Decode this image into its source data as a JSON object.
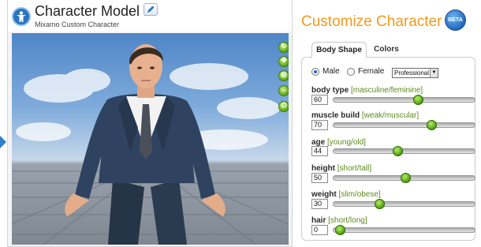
{
  "model": {
    "title": "Character Model 1",
    "subtitle": "Mixamo Custom Character",
    "icons": [
      "app-logo-icon",
      "edit-icon"
    ]
  },
  "viewport_tools": [
    "rotate-icon",
    "move-icon",
    "zoom-icon",
    "walk-icon",
    "reset-icon"
  ],
  "customize": {
    "title": "Customize Character",
    "badge": "BETA",
    "tabs": [
      {
        "label": "Body Shape",
        "active": true
      },
      {
        "label": "Colors",
        "active": false
      }
    ],
    "gender": {
      "options": [
        {
          "label": "Male",
          "checked": true
        },
        {
          "label": "Female",
          "checked": false
        }
      ],
      "preset_select": "Professional"
    },
    "sliders": [
      {
        "name": "body type",
        "range": "[masculine/feminine]",
        "value": "60",
        "fraction": 0.6
      },
      {
        "name": "muscle build",
        "range": "[weak/muscular]",
        "value": "70",
        "fraction": 0.7
      },
      {
        "name": "age",
        "range": "[young/old]",
        "value": "44",
        "fraction": 0.44
      },
      {
        "name": "height",
        "range": "[short/tall]",
        "value": "50",
        "fraction": 0.5
      },
      {
        "name": "weight",
        "range": "[slim/obese]",
        "value": "30",
        "fraction": 0.3
      },
      {
        "name": "hair",
        "range": "[short/long]",
        "value": "0",
        "fraction": 0.0
      }
    ]
  },
  "colors": {
    "accent": "#f39a1e",
    "slider_green": "#5aa815",
    "range_green": "#5c8a1a",
    "badge_blue": "#1f63b8"
  }
}
